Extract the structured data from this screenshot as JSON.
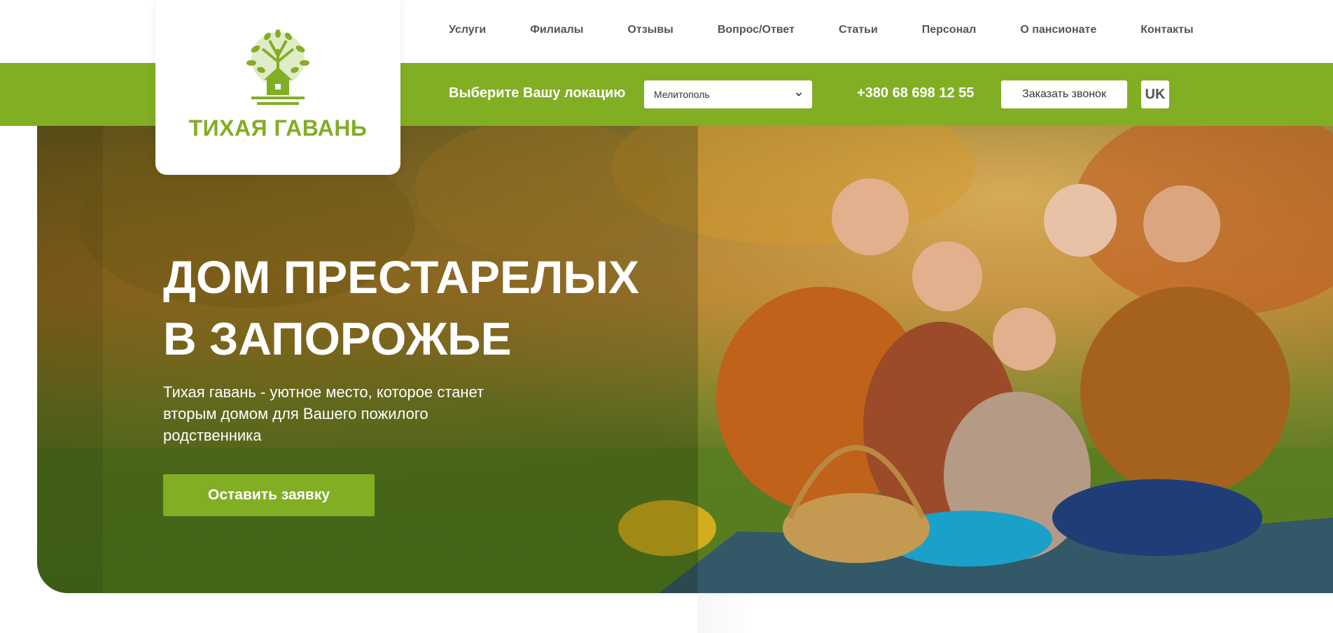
{
  "brand": {
    "name": "ТИХАЯ ГАВАНЬ",
    "logo_icon": "tree-house-icon",
    "color": "#82ae24"
  },
  "nav": {
    "items": [
      {
        "label": "Услуги"
      },
      {
        "label": "Филиалы"
      },
      {
        "label": "Отзывы"
      },
      {
        "label": "Вопрос/Ответ"
      },
      {
        "label": "Статьи"
      },
      {
        "label": "Персонал"
      },
      {
        "label": "О пансионате"
      },
      {
        "label": "Контакты"
      }
    ]
  },
  "location_bar": {
    "label": "Выберите Вашу локацию",
    "selected_city": "Мелитополь",
    "phone": "+380 68 698 12 55",
    "callback_label": "Заказать звонок",
    "language": "UK"
  },
  "hero": {
    "title_line1": "ДОМ ПРЕСТАРЕЛЫХ",
    "title_line2": "В ЗАПОРОЖЬЕ",
    "subtitle": "Тихая гавань - уютное место, которое станет вторым домом для Вашего пожилого родственника",
    "cta_label": "Оставить заявку",
    "image": "family-picnic-autumn-park-photo"
  },
  "colors": {
    "accent": "#82ae24",
    "nav_text": "#555555",
    "white": "#ffffff"
  }
}
